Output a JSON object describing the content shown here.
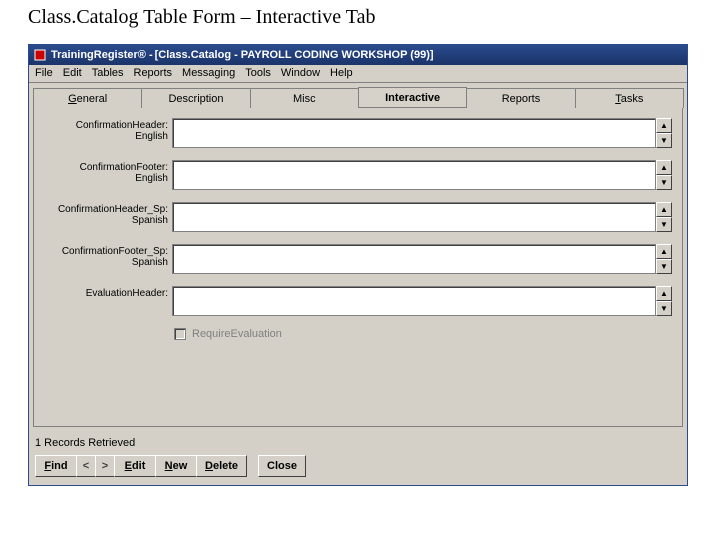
{
  "doc": {
    "heading": "Class.Catalog Table Form – Interactive Tab"
  },
  "titlebar": {
    "app": "TrainingRegister® -",
    "doc": "[Class.Catalog - PAYROLL CODING WORKSHOP (99)]"
  },
  "menu": {
    "file": "File",
    "edit": "Edit",
    "tables": "Tables",
    "reports": "Reports",
    "messaging": "Messaging",
    "tools": "Tools",
    "window": "Window",
    "help": "Help"
  },
  "tabs": {
    "general": "General",
    "description": "Description",
    "misc": "Misc",
    "interactive": "Interactive",
    "reports": "Reports",
    "tasks": "Tasks"
  },
  "fields": {
    "confHeader": {
      "l1": "ConfirmationHeader:",
      "l2": "English",
      "value": ""
    },
    "confFooter": {
      "l1": "ConfirmationFooter:",
      "l2": "English",
      "value": ""
    },
    "confHeaderSp": {
      "l1": "ConfirmationHeader_Sp:",
      "l2": "Spanish",
      "value": ""
    },
    "confFooterSp": {
      "l1": "ConfirmationFooter_Sp:",
      "l2": "Spanish",
      "value": ""
    },
    "evalHeader": {
      "l1": "EvaluationHeader:",
      "l2": "",
      "value": ""
    }
  },
  "checkbox": {
    "label": "RequireEvaluation",
    "enabled": false,
    "checked": false
  },
  "status": {
    "text": "1 Records Retrieved"
  },
  "buttons": {
    "find": "Find",
    "prev": "<",
    "next": ">",
    "edit": "Edit",
    "new": "New",
    "delete": "Delete",
    "close": "Close"
  }
}
